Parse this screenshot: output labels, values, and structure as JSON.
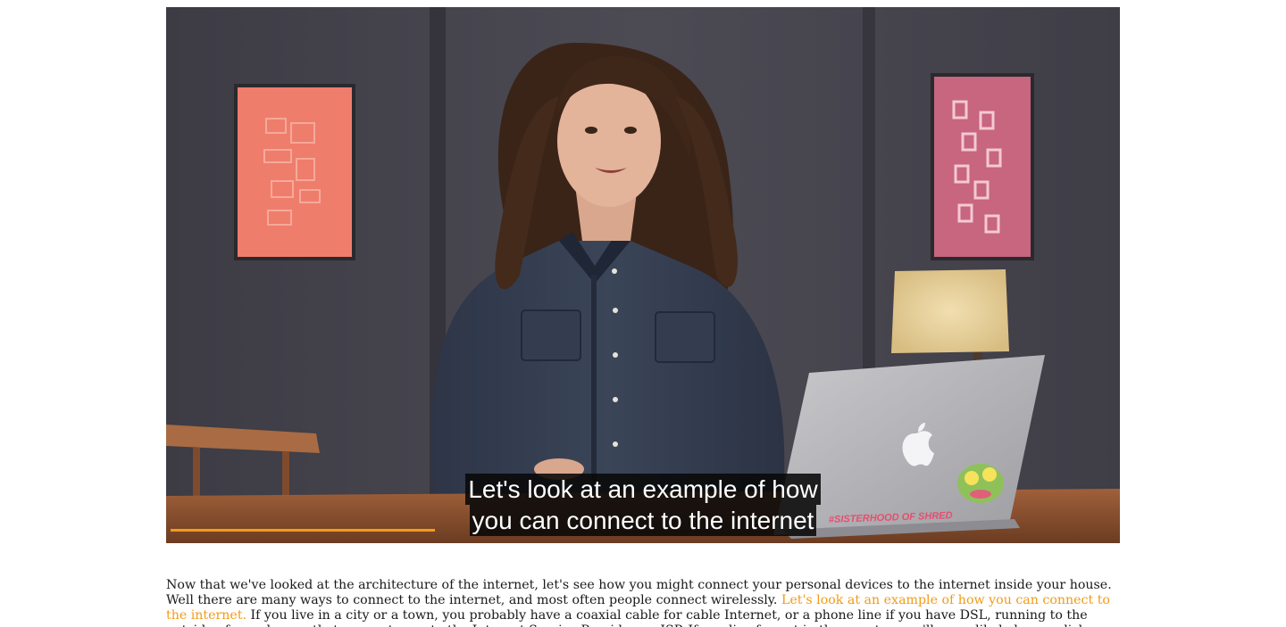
{
  "video": {
    "caption_lines": [
      "Let's look at an example of how",
      "you can connect to the internet"
    ],
    "progress": 0.28,
    "accent_color": "#f29b17"
  },
  "transcript": {
    "segments": [
      {
        "text": "Now that we've looked at the architecture of the internet, let's see how you might connect your personal devices to the internet inside your house. Well there are many ways to connect to the internet, and most often people connect wirelessly. ",
        "active": false
      },
      {
        "text": "Let's look at an example of how you can connect to the internet.",
        "active": true
      },
      {
        "text": " If you live in a city or a town, you probably have a coaxial cable for cable Internet, or a phone line if you have DSL, running to the outside of your house, that connects you to the Internet Service Provider, or ISP. If you live far out in the country, you'll more likely have a dish outside your house, connecting you wirelessly to your closest ISP.",
        "active": false
      }
    ]
  }
}
